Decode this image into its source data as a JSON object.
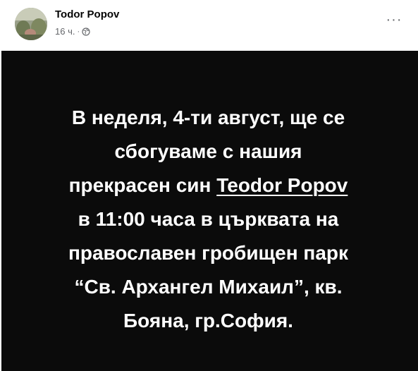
{
  "post": {
    "author": "Todor Popov",
    "time": "16 ч.",
    "separator": "·",
    "audience_icon": "globe-icon",
    "more_icon": "more-options-icon",
    "more_label": "···"
  },
  "announcement": {
    "line1": "В неделя, 4-ти август, ще се",
    "line2": "сбогуваме с нашия",
    "line3_pre": "прекрасен син ",
    "line3_mention": "Teodor Popov",
    "line4": "в 11:00 часа в църквата на",
    "line5": "православен гробищен парк",
    "line6": "“Св. Архангел Михаил”, кв.",
    "line7": "Бояна, гр.София."
  },
  "colors": {
    "background": "#0b0b0b",
    "text": "#ffffff",
    "meta_text": "#65676b"
  }
}
